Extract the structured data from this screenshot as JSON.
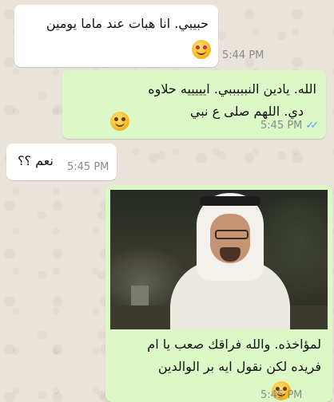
{
  "chat": {
    "messages": [
      {
        "id": "m1",
        "direction": "incoming",
        "text": "حبيبي. انا هبات عند ماما يومين",
        "time": "5:44 PM",
        "emoji": "heart-eyes-emoji"
      },
      {
        "id": "m2",
        "direction": "outgoing",
        "line1": "الله. يادين النبببببي. ايييييه حلاوه",
        "line2": "دي. اللهم صلى ع نبي",
        "time": "5:45 PM",
        "emoji": "hug-emoji",
        "ticks": "✓✓"
      },
      {
        "id": "m3",
        "direction": "incoming",
        "text": "نعم ؟؟",
        "time": "5:45 PM"
      },
      {
        "id": "m4",
        "direction": "outgoing",
        "image": "man-in-ghutra-photo",
        "line1": "لمؤاخذه. والله فراقك صعب يا ام",
        "line2": "فريده لكن نقول ايه بر الوالدين",
        "time": "5:45 PM",
        "emoji": "laughing-emoji"
      }
    ]
  },
  "colors": {
    "incoming_bubble": "#ffffff",
    "outgoing_bubble": "#dcf8c6",
    "read_ticks": "#4fa3e8",
    "wallpaper": "#e9e3da"
  }
}
